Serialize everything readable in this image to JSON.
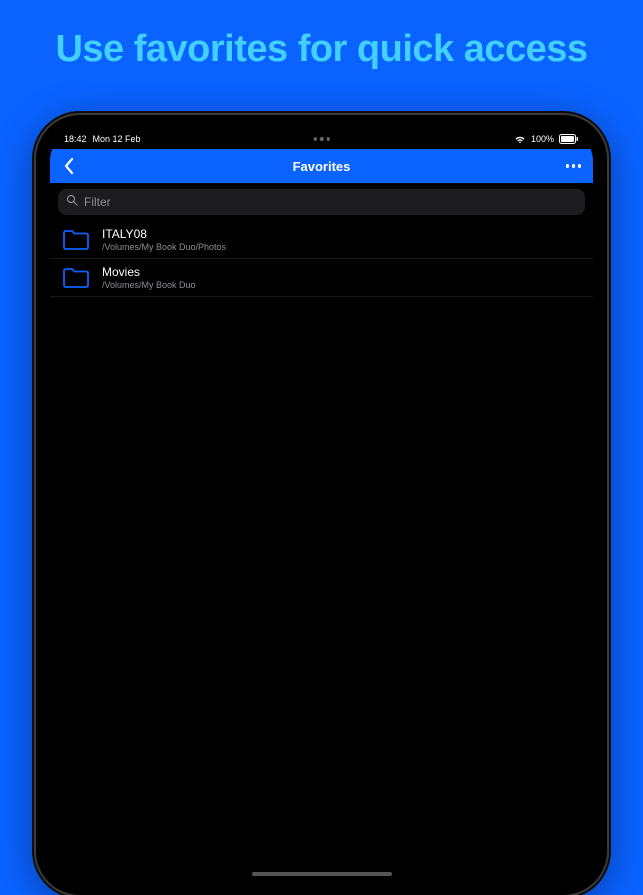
{
  "headline": "Use favorites for quick access",
  "status": {
    "time": "18:42",
    "date": "Mon 12 Feb",
    "battery_pct": "100%"
  },
  "nav": {
    "title": "Favorites"
  },
  "search": {
    "placeholder": "Filter"
  },
  "items": [
    {
      "title": "ITALY08",
      "path": "/Volumes/My Book Duo/Photos"
    },
    {
      "title": "Movies",
      "path": "/Volumes/My Book Duo"
    }
  ]
}
